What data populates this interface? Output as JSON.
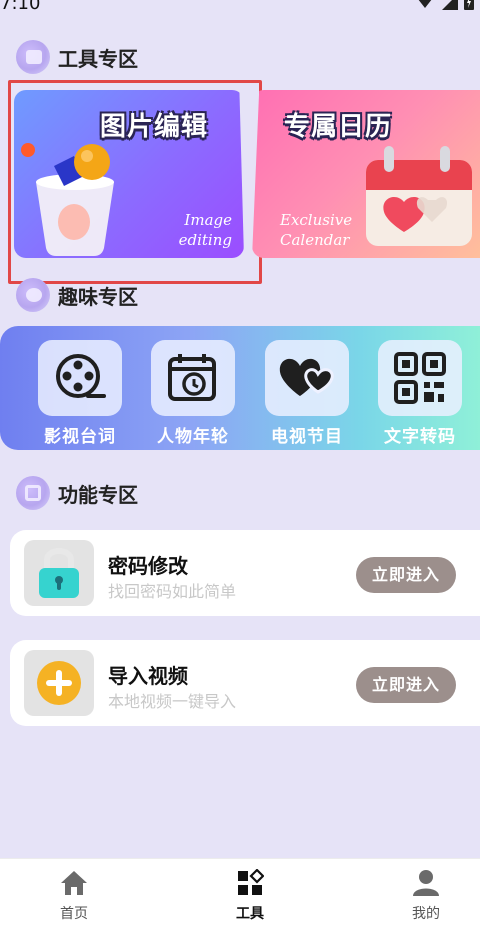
{
  "status_bar": {
    "time": "7:10"
  },
  "sections": {
    "tools_title": "工具专区",
    "fun_title": "趣味专区",
    "function_title": "功能专区"
  },
  "tool_cards": [
    {
      "title": "图片编辑",
      "subtitle_line1": "Image",
      "subtitle_line2": "editing"
    },
    {
      "title": "专属日历",
      "subtitle_line1": "Exclusive",
      "subtitle_line2": "Calendar"
    }
  ],
  "fun_items": [
    {
      "label": "影视台词",
      "icon": "film-reel-icon"
    },
    {
      "label": "人物年轮",
      "icon": "calendar-clock-icon"
    },
    {
      "label": "电视节目",
      "icon": "hearts-icon"
    },
    {
      "label": "文字转码",
      "icon": "qr-code-icon"
    }
  ],
  "function_items": [
    {
      "title": "密码修改",
      "subtitle": "找回密码如此简单",
      "button": "立即进入",
      "icon": "padlock-icon"
    },
    {
      "title": "导入视频",
      "subtitle": "本地视频一键导入",
      "button": "立即进入",
      "icon": "plus-circle-icon"
    }
  ],
  "bottom_nav": [
    {
      "label": "首页",
      "icon": "home-icon"
    },
    {
      "label": "工具",
      "icon": "tools-grid-icon",
      "active": true
    },
    {
      "label": "我的",
      "icon": "user-icon"
    }
  ]
}
